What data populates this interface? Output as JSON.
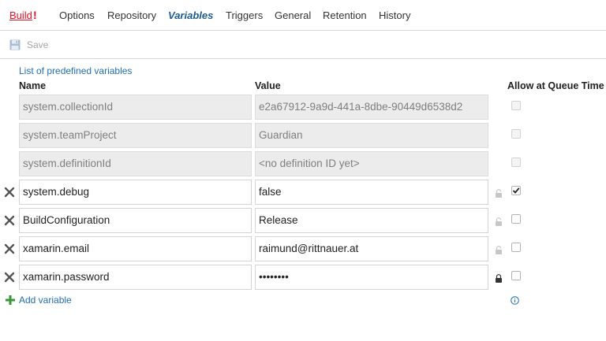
{
  "tabs": [
    {
      "label": "Build",
      "badge": "!"
    },
    {
      "label": "Options"
    },
    {
      "label": "Repository"
    },
    {
      "label": "Variables"
    },
    {
      "label": "Triggers"
    },
    {
      "label": "General"
    },
    {
      "label": "Retention"
    },
    {
      "label": "History"
    }
  ],
  "active_tab": "Variables",
  "toolbar": {
    "save_label": "Save",
    "save_icon": "floppy-disk-icon"
  },
  "predefined_link": "List of predefined variables",
  "columns": {
    "name": "Name",
    "value": "Value",
    "allow": "Allow at Queue Time"
  },
  "variables": [
    {
      "name": "system.collectionId",
      "value": "e2a67912-9a9d-441a-8dbe-90449d6538d2",
      "readonly": true,
      "allow_queue": false
    },
    {
      "name": "system.teamProject",
      "value": "Guardian",
      "readonly": true,
      "allow_queue": false
    },
    {
      "name": "system.definitionId",
      "value": "<no definition ID yet>",
      "readonly": true,
      "allow_queue": false
    },
    {
      "name": "system.debug",
      "value": "false",
      "readonly": false,
      "secret": false,
      "allow_queue": true
    },
    {
      "name": "BuildConfiguration",
      "value": "Release",
      "readonly": false,
      "secret": false,
      "allow_queue": false
    },
    {
      "name": "xamarin.email",
      "value": "raimund@rittnauer.at",
      "readonly": false,
      "secret": false,
      "allow_queue": false
    },
    {
      "name": "xamarin.password",
      "value": "••••••••",
      "readonly": false,
      "secret": true,
      "allow_queue": false
    }
  ],
  "add_variable_label": "Add variable",
  "colors": {
    "accent": "#1d5c93",
    "link": "#1f6fb7",
    "error": "#e81123",
    "add": "#339933"
  }
}
